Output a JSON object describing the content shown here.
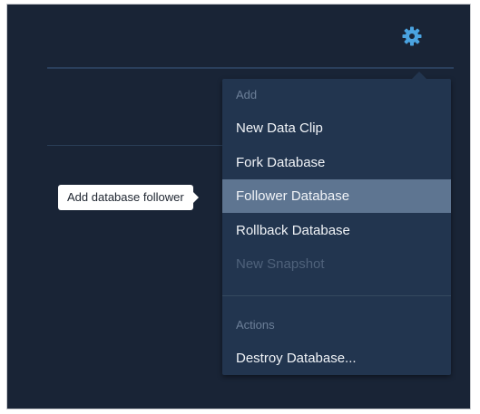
{
  "toolbar": {
    "settings_icon": "gear-icon",
    "icon_color": "#4aa3e0"
  },
  "menu": {
    "add_section_label": "Add",
    "add_items": [
      {
        "label": "New Data Clip",
        "state": "normal"
      },
      {
        "label": "Fork Database",
        "state": "normal"
      },
      {
        "label": "Follower Database",
        "state": "selected"
      },
      {
        "label": "Rollback Database",
        "state": "normal"
      },
      {
        "label": "New Snapshot",
        "state": "disabled"
      }
    ],
    "actions_section_label": "Actions",
    "action_items": [
      {
        "label": "Destroy Database...",
        "state": "normal"
      }
    ]
  },
  "tooltip": {
    "text": "Add database follower"
  },
  "colors": {
    "background": "#192436",
    "menu_background": "#22354f",
    "selected_background": "#5e7591",
    "disabled_text": "#4f627b"
  }
}
